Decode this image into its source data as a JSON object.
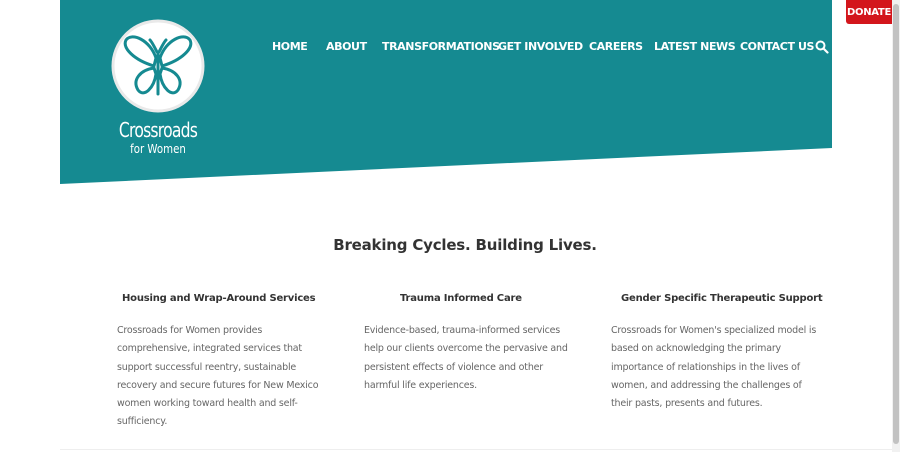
{
  "logo": {
    "title": "Crossroads",
    "subtitle": "for Women",
    "icon": "butterfly-icon"
  },
  "nav": {
    "items": [
      {
        "label": "HOME"
      },
      {
        "label": "ABOUT"
      },
      {
        "label": "TRANSFORMATIONS"
      },
      {
        "label": "GET INVOLVED"
      },
      {
        "label": "CAREERS"
      },
      {
        "label": "LATEST NEWS"
      },
      {
        "label": "CONTACT US"
      }
    ],
    "search_icon": "search-icon"
  },
  "donate": {
    "label": "DONATE"
  },
  "tagline": "Breaking Cycles. Building Lives.",
  "services": [
    {
      "title": "Housing and Wrap-Around Services",
      "text": "Crossroads for Women provides comprehensive, integrated services that support successful reentry, sustainable recovery and secure futures for New Mexico women working toward health and self-sufficiency."
    },
    {
      "title": "Trauma Informed Care",
      "text": "Evidence-based, trauma-informed services help our clients overcome the pervasive and persistent effects of violence and other harmful life experiences."
    },
    {
      "title": "Gender Specific Therapeutic Support",
      "text": "Crossroads for Women's specialized model is based on acknowledging the primary importance of relationships in the lives of women, and addressing the challenges of their pasts, presents and futures."
    }
  ],
  "colors": {
    "header_bg": "#158a91",
    "donate_bg": "#d3161c",
    "text": "#333333",
    "body_text": "#666666"
  }
}
